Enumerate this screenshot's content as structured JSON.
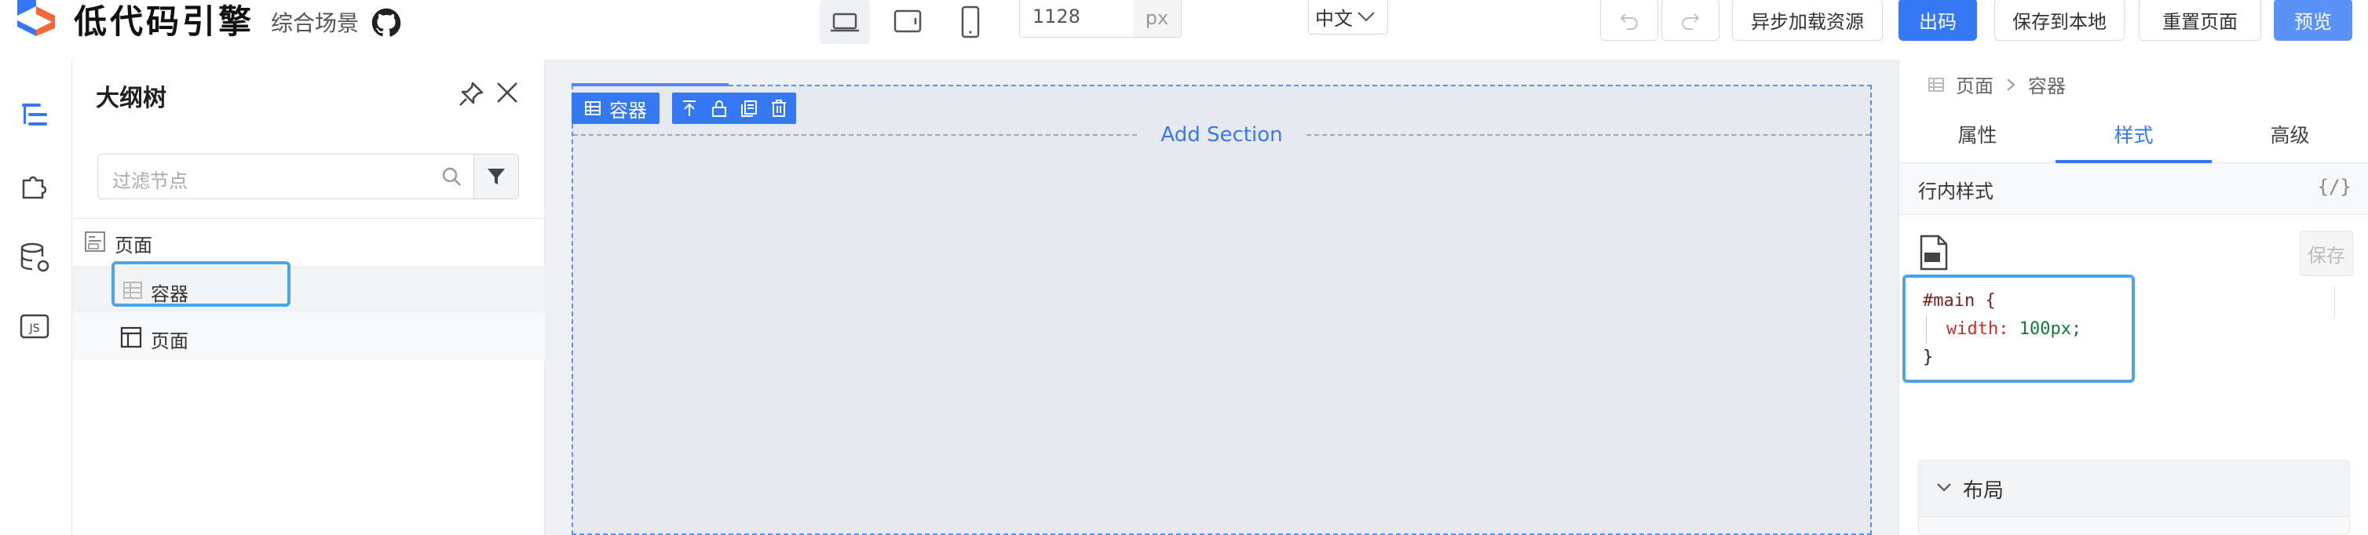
{
  "header": {
    "app_title": "低代码引擎",
    "scene_label": "综合场景",
    "canvas_width_value": "1128",
    "canvas_width_unit": "px",
    "language": "中文",
    "buttons": {
      "async_load": "异步加载资源",
      "export": "出码",
      "save_local": "保存到本地",
      "reset_page": "重置页面",
      "preview": "预览"
    },
    "accent_color": "#3478f6"
  },
  "sidebar": {
    "items": [
      {
        "icon": "outline-tree-icon"
      },
      {
        "icon": "plugin-puzzle-icon"
      },
      {
        "icon": "datasource-icon"
      },
      {
        "icon": "js-code-icon",
        "label": "JS"
      }
    ]
  },
  "outline": {
    "title": "大纲树",
    "filter_placeholder": "过滤节点",
    "tree": [
      {
        "label": "页面",
        "icon": "page-icon"
      },
      {
        "label": "容器",
        "icon": "table-grid-icon",
        "selected": true
      },
      {
        "label": "页面",
        "icon": "layout-icon"
      }
    ]
  },
  "canvas": {
    "selected_tag": "容器",
    "add_section": "Add Section"
  },
  "settings": {
    "breadcrumb": [
      "页面",
      "容器"
    ],
    "tabs": [
      "属性",
      "样式",
      "高级"
    ],
    "active_tab": "样式",
    "inline_style_title": "行内样式",
    "inline_style_toggle": "{/}",
    "save_label": "保存",
    "code": {
      "selector": "#main {",
      "property": "width:",
      "value": "100px;",
      "close": "}"
    },
    "layout_section_title": "布局"
  }
}
